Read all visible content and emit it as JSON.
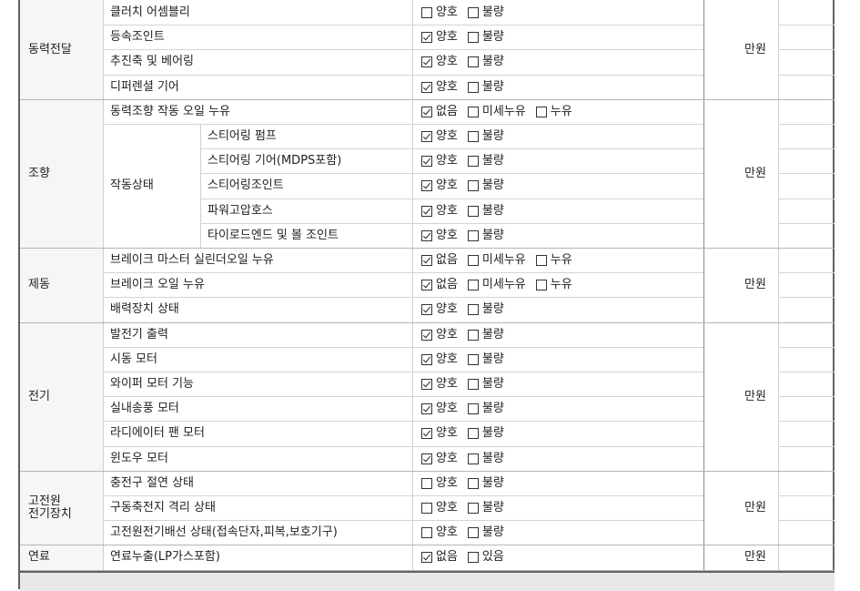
{
  "sections": [
    {
      "name": "동력전달",
      "unit": "만원"
    },
    {
      "name": "조향",
      "unit": "만원"
    },
    {
      "name": "제동",
      "unit": "만원"
    },
    {
      "name": "전기",
      "unit": "만원"
    },
    {
      "name": "고전원\n전기장치",
      "unit": "만원"
    },
    {
      "name": "연료",
      "unit": "만원"
    }
  ],
  "subgroups": [
    {
      "label": "작동상태"
    }
  ],
  "rows": [
    {
      "item": "클러치 어셈블리",
      "options": [
        {
          "label": "양호",
          "checked": false
        },
        {
          "label": "불량",
          "checked": false
        }
      ]
    },
    {
      "item": "등속조인트",
      "options": [
        {
          "label": "양호",
          "checked": true
        },
        {
          "label": "불량",
          "checked": false
        }
      ]
    },
    {
      "item": "추진축 및 베어링",
      "options": [
        {
          "label": "양호",
          "checked": true
        },
        {
          "label": "불량",
          "checked": false
        }
      ]
    },
    {
      "item": "디퍼렌셜 기어",
      "options": [
        {
          "label": "양호",
          "checked": true
        },
        {
          "label": "불량",
          "checked": false
        }
      ]
    },
    {
      "item": "동력조향 작동 오일 누유",
      "options": [
        {
          "label": "없음",
          "checked": true
        },
        {
          "label": "미세누유",
          "checked": false
        },
        {
          "label": "누유",
          "checked": false
        }
      ]
    },
    {
      "item": "스티어링 펌프",
      "options": [
        {
          "label": "양호",
          "checked": true
        },
        {
          "label": "불량",
          "checked": false
        }
      ]
    },
    {
      "item": "스티어링 기어(MDPS포함)",
      "options": [
        {
          "label": "양호",
          "checked": true
        },
        {
          "label": "불량",
          "checked": false
        }
      ]
    },
    {
      "item": "스티어링조인트",
      "options": [
        {
          "label": "양호",
          "checked": true
        },
        {
          "label": "불량",
          "checked": false
        }
      ]
    },
    {
      "item": "파워고압호스",
      "options": [
        {
          "label": "양호",
          "checked": true
        },
        {
          "label": "불량",
          "checked": false
        }
      ]
    },
    {
      "item": "타이로드엔드 및 볼 조인트",
      "options": [
        {
          "label": "양호",
          "checked": true
        },
        {
          "label": "불량",
          "checked": false
        }
      ]
    },
    {
      "item": "브레이크 마스터 실린더오일 누유",
      "options": [
        {
          "label": "없음",
          "checked": true
        },
        {
          "label": "미세누유",
          "checked": false
        },
        {
          "label": "누유",
          "checked": false
        }
      ]
    },
    {
      "item": "브레이크 오일 누유",
      "options": [
        {
          "label": "없음",
          "checked": true
        },
        {
          "label": "미세누유",
          "checked": false
        },
        {
          "label": "누유",
          "checked": false
        }
      ]
    },
    {
      "item": "배력장치 상태",
      "options": [
        {
          "label": "양호",
          "checked": true
        },
        {
          "label": "불량",
          "checked": false
        }
      ]
    },
    {
      "item": "발전기 출력",
      "options": [
        {
          "label": "양호",
          "checked": true
        },
        {
          "label": "불량",
          "checked": false
        }
      ]
    },
    {
      "item": "시동 모터",
      "options": [
        {
          "label": "양호",
          "checked": true
        },
        {
          "label": "불량",
          "checked": false
        }
      ]
    },
    {
      "item": "와이퍼 모터 기능",
      "options": [
        {
          "label": "양호",
          "checked": true
        },
        {
          "label": "불량",
          "checked": false
        }
      ]
    },
    {
      "item": "실내송풍 모터",
      "options": [
        {
          "label": "양호",
          "checked": true
        },
        {
          "label": "불량",
          "checked": false
        }
      ]
    },
    {
      "item": "라디에이터 팬 모터",
      "options": [
        {
          "label": "양호",
          "checked": true
        },
        {
          "label": "불량",
          "checked": false
        }
      ]
    },
    {
      "item": "윈도우 모터",
      "options": [
        {
          "label": "양호",
          "checked": true
        },
        {
          "label": "불량",
          "checked": false
        }
      ]
    },
    {
      "item": "충전구 절연 상태",
      "options": [
        {
          "label": "양호",
          "checked": false
        },
        {
          "label": "불량",
          "checked": false
        }
      ]
    },
    {
      "item": "구동축전지 격리 상태",
      "options": [
        {
          "label": "양호",
          "checked": false
        },
        {
          "label": "불량",
          "checked": false
        }
      ]
    },
    {
      "item": "고전원전기배선 상태(접속단자,피복,보호기구)",
      "options": [
        {
          "label": "양호",
          "checked": false
        },
        {
          "label": "불량",
          "checked": false
        }
      ]
    },
    {
      "item": "연료누출(LP가스포함)",
      "options": [
        {
          "label": "없음",
          "checked": true
        },
        {
          "label": "있음",
          "checked": false
        }
      ]
    }
  ]
}
